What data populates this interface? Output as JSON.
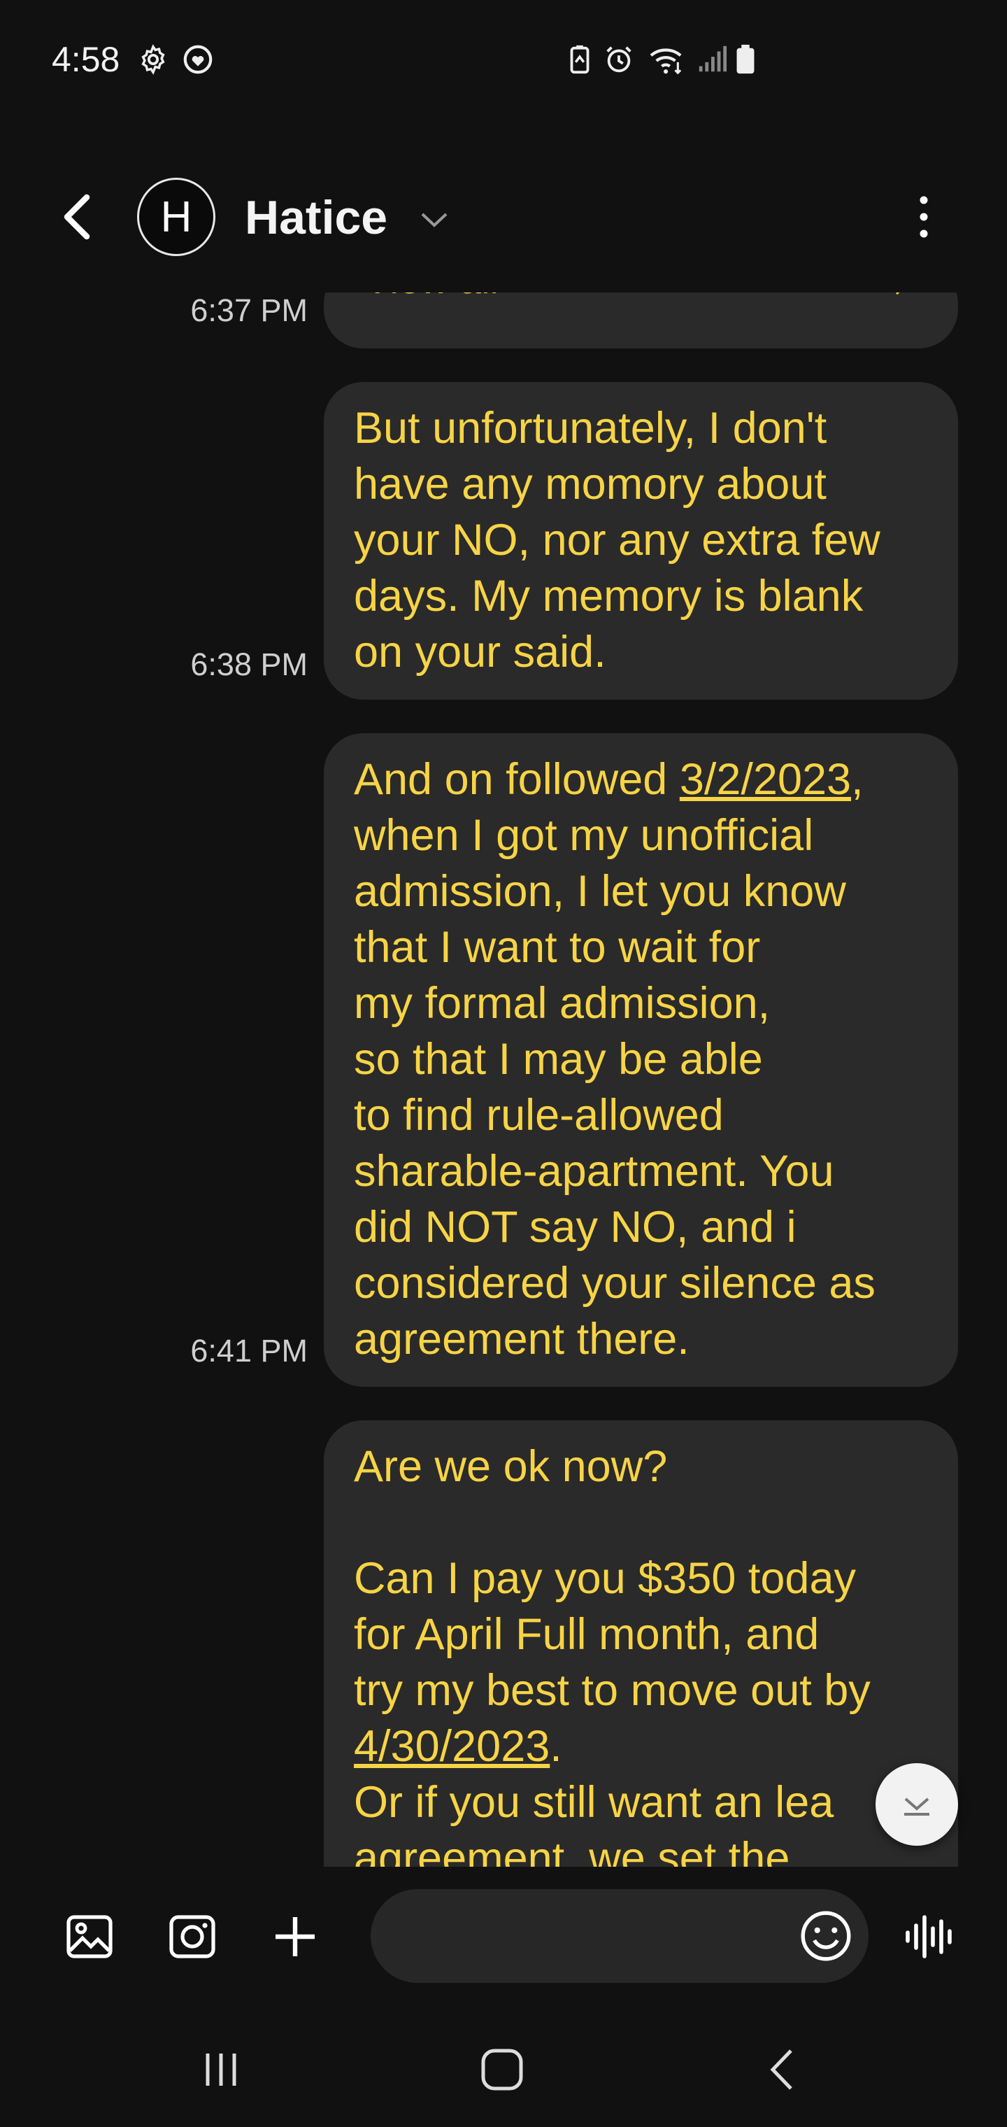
{
  "status_bar": {
    "time": "4:58",
    "icons": [
      "settings-icon",
      "heart-badge-icon",
      "battery-saver-icon",
      "alarm-icon",
      "wifi-icon",
      "signal-icon",
      "battery-icon"
    ]
  },
  "header": {
    "avatar_initial": "H",
    "contact_name": "Hatice",
    "icons": [
      "back-arrow-icon",
      "chevron-down-icon",
      "more-vertical-icon"
    ]
  },
  "messages": [
    {
      "type": "view_all",
      "label": "View all",
      "timestamp": "6:37 PM"
    },
    {
      "timestamp": "6:38 PM",
      "text": "But unfortunately, I don't\nhave any momory about\nyour NO, nor any extra few\ndays. My memory is blank\non your said."
    },
    {
      "timestamp": "6:41 PM",
      "text_before_link": "And on followed ",
      "link": "3/2/2023",
      "text_after_link": ",\nwhen I got my unofficial\nadmission, I let you know\nthat I want to wait for\nmy formal admission,\nso that I may be able\nto find rule-allowed\nsharable-apartment. You\ndid NOT say NO, and i\nconsidered your silence as\nagreement there."
    },
    {
      "text_before_link": "Are we ok now?\n\nCan I pay you $350 today\nfor April Full month, and\ntry my best to move out by\n",
      "link": "4/30/2023",
      "text_after_link": ".\nOr if you still want an lea\nagreement, we set the\nd\nsc"
    }
  ],
  "composer": {
    "placeholder": "",
    "icons": [
      "gallery-icon",
      "camera-icon",
      "plus-icon",
      "emoji-icon",
      "voice-waveform-icon"
    ]
  },
  "colors": {
    "background": "#111111",
    "bubble": "#2a2a2a",
    "message_text": "#f7d446",
    "timestamp": "#cfcfcf"
  }
}
